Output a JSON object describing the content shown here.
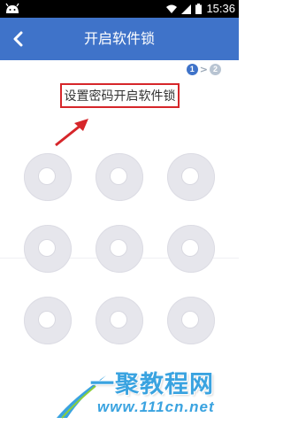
{
  "status_bar": {
    "time": "15:36"
  },
  "header": {
    "title": "开启软件锁",
    "back_icon": "chevron-left-icon"
  },
  "steps": {
    "current": "1",
    "next": "2",
    "separator": ">"
  },
  "instruction": "设置密码开启软件锁",
  "pattern": {
    "rows": 3,
    "cols": 3
  },
  "watermark": {
    "name": "一聚教程网",
    "url": "www.111cn.net"
  },
  "colors": {
    "header": "#3f73c9",
    "highlight_box": "#d6262a",
    "annotation_arrow": "#d6262a",
    "watermark": "#3aa3e0"
  }
}
